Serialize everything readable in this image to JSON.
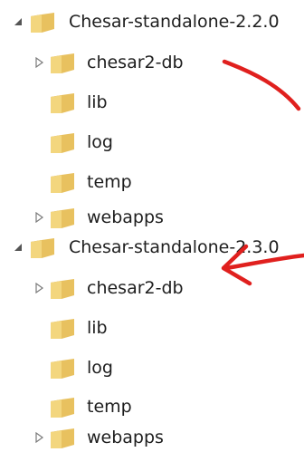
{
  "tree": {
    "groups": [
      {
        "root": {
          "label": "Chesar-standalone-2.2.0",
          "expanded": true
        },
        "children": [
          {
            "label": "chesar2-db",
            "has_children": true
          },
          {
            "label": "lib",
            "has_children": false
          },
          {
            "label": "log",
            "has_children": false
          },
          {
            "label": "temp",
            "has_children": false
          },
          {
            "label": "webapps",
            "has_children": true
          }
        ]
      },
      {
        "root": {
          "label": "Chesar-standalone-2.3.0",
          "expanded": true
        },
        "children": [
          {
            "label": "chesar2-db",
            "has_children": true
          },
          {
            "label": "lib",
            "has_children": false
          },
          {
            "label": "log",
            "has_children": false
          },
          {
            "label": "temp",
            "has_children": false
          },
          {
            "label": "webapps",
            "has_children": true
          }
        ]
      }
    ]
  },
  "colors": {
    "folder_body": "#e8c15f",
    "folder_dark": "#c99a33",
    "annotation_arrow": "#e0201e",
    "text": "#1e1e1e"
  },
  "icons": {
    "expanded": "triangle-down-expanded-icon",
    "collapsed": "triangle-right-collapsed-icon",
    "folder": "folder-icon",
    "annotation": "red-arrow-annotation"
  }
}
